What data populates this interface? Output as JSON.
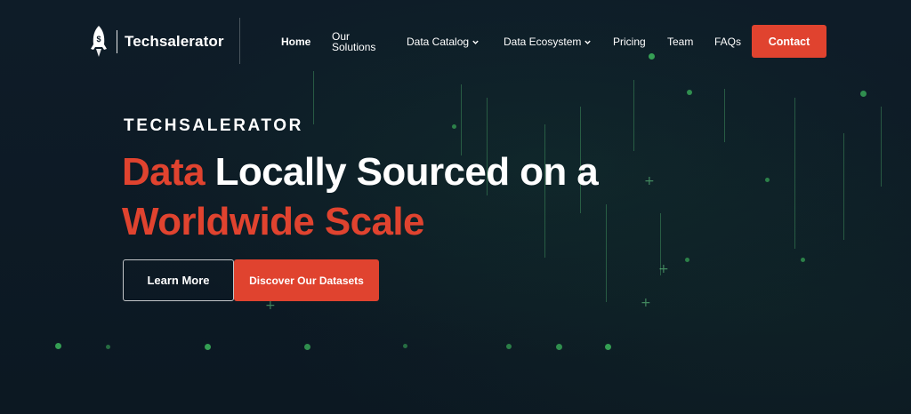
{
  "brand": {
    "name": "Techsalerator",
    "icon": "rocket-dollar-icon"
  },
  "nav": {
    "items": [
      {
        "label": "Home",
        "active": true
      },
      {
        "label_line1": "Our",
        "label_line2": "Solutions"
      },
      {
        "label": "Data Catalog",
        "dropdown": true,
        "icon": "chevron-down-icon"
      },
      {
        "label": "Data Ecosystem",
        "dropdown": true,
        "icon": "chevron-down-icon"
      },
      {
        "label": "Pricing"
      },
      {
        "label": "Team"
      },
      {
        "label": "FAQs"
      }
    ],
    "contact_label": "Contact"
  },
  "hero": {
    "eyebrow": "TECHSALERATOR",
    "headline": {
      "accent_1": "Data",
      "rest_1": " Locally Sourced on a",
      "accent_2": "Worldwide Scale"
    },
    "buttons": {
      "learn_more": "Learn More",
      "discover": "Discover Our Datasets"
    }
  },
  "colors": {
    "background": "#0d1a26",
    "accent": "#e0432f",
    "text": "#ffffff",
    "matrix_green": "#3fbf5f"
  }
}
